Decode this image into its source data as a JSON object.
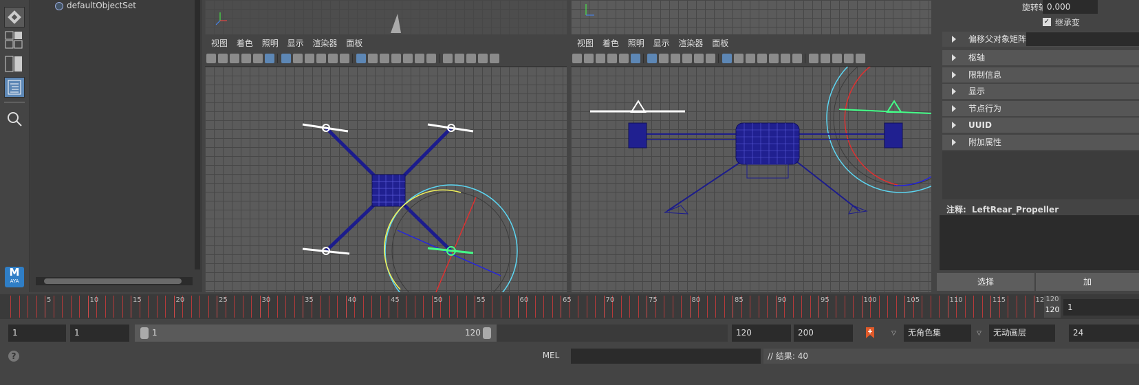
{
  "toolbar": {
    "logo_text": "AYA",
    "logo_letter": "M"
  },
  "outliner": {
    "items": [
      {
        "label": "defaultObjectSet"
      }
    ]
  },
  "viewport_menu": [
    "视图",
    "着色",
    "照明",
    "显示",
    "渲染器",
    "面板"
  ],
  "attribute_editor": {
    "rotate_axis_label": "旋转轴",
    "rotate_axis_value": "0.000",
    "inherit_label": "继承变",
    "offset_parent_matrix": "偏移父对象矩阵",
    "sections": [
      "枢轴",
      "限制信息",
      "显示",
      "节点行为",
      "UUID",
      "附加属性"
    ],
    "note_label": "注释:",
    "note_value": "LeftRear_Propeller",
    "select_button": "选择",
    "add_button": "加"
  },
  "timeline": {
    "labels": [
      "5",
      "10",
      "15",
      "20",
      "25",
      "30",
      "35",
      "40",
      "45",
      "50",
      "55",
      "60",
      "65",
      "70",
      "75",
      "80",
      "85",
      "90",
      "95",
      "100",
      "105",
      "110",
      "115",
      "120"
    ],
    "current_frame_top": "120",
    "current_frame_bottom": "120",
    "current_frame_field": "1"
  },
  "range": {
    "start": "1",
    "playback_start": "1",
    "slider_start": "1",
    "slider_end": "120",
    "playback_end": "120",
    "end": "200",
    "character_set": "无角色集",
    "anim_layer": "无动画层",
    "fps": "24"
  },
  "command_line": {
    "help_icon": "?",
    "language": "MEL",
    "result": "// 结果: 40"
  },
  "colors": {
    "timeline_tick": "#b53a3a",
    "selected_tool": "#5d87b5",
    "wireframe": "#1c1c8c",
    "selection_green": "#44ff88"
  }
}
